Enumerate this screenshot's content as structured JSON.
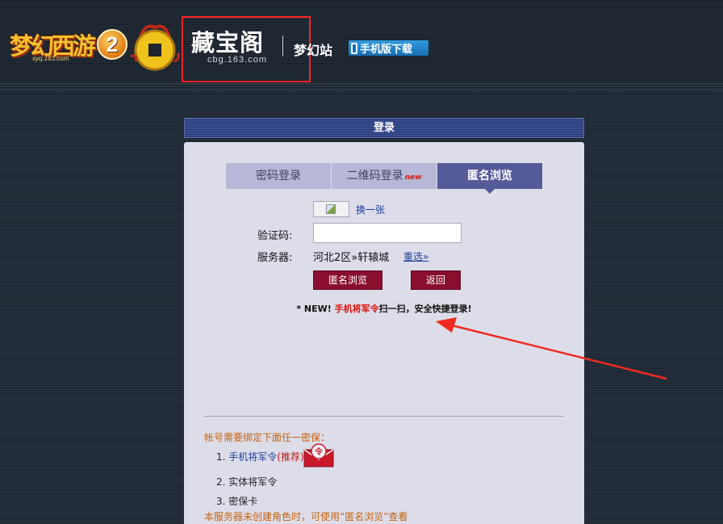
{
  "header": {
    "game_logo_text": "梦幻西游",
    "game_logo_number": "2",
    "game_logo_url": "xyq.163.com",
    "cbg_title": "藏宝阁",
    "cbg_url": "cbg.163.com",
    "site_name": "梦幻站",
    "mobile_download": "手机版下载"
  },
  "panel": {
    "title": "登录",
    "tabs": [
      {
        "label": "密码登录",
        "active": false
      },
      {
        "label": "二维码登录",
        "badge": "new",
        "active": false
      },
      {
        "label": "匿名浏览",
        "active": true
      }
    ],
    "captcha_refresh": "换一张",
    "captcha_label": "验证码:",
    "captcha_value": "",
    "server_label": "服务器:",
    "server_value": "河北2区»轩辕城",
    "reselect": "重选»",
    "browse_button": "匿名浏览",
    "back_button": "返回",
    "notice": {
      "prefix": "* NEW! ",
      "highlight": "手机将军令",
      "suffix": "扫一扫，安全快捷登录!"
    },
    "bind_title": "帐号需要绑定下面任一密保：",
    "options": [
      {
        "num": "1.",
        "label": "手机将军令",
        "tag": "(推荐)"
      },
      {
        "num": "2.",
        "label": "实体将军令"
      },
      {
        "num": "3.",
        "label": "密保卡"
      }
    ],
    "ling_icon_char": "令",
    "bottom_note": "本服务器未创建角色时，可使用“匿名浏览”查看"
  },
  "colors": {
    "annotation_red": "#ff2424",
    "button_maroon": "#8a0f2e",
    "tab_active": "#555a99",
    "warning_orange": "#c8620e"
  }
}
